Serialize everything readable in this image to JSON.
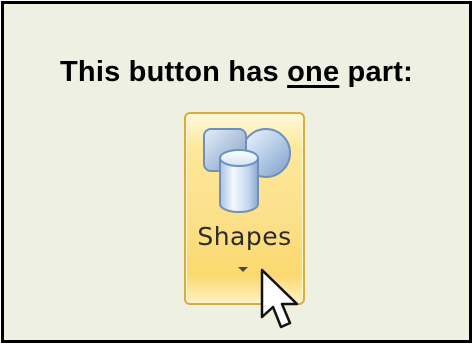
{
  "heading": {
    "text_before": "This button has ",
    "emphasis": "one",
    "text_after": " part:"
  },
  "ribbon_button": {
    "label": "Shapes",
    "icon": "shapes-icon",
    "has_dropdown_arrow": true,
    "state": "hover"
  },
  "cursor": {
    "icon": "arrow-cursor-icon"
  },
  "colors": {
    "background": "#eef0e2",
    "border": "#000000",
    "button_hover_border": "#d8ac3d",
    "button_hover_fill": "#fbe08a",
    "shape_blue": "#8fb2d8"
  }
}
